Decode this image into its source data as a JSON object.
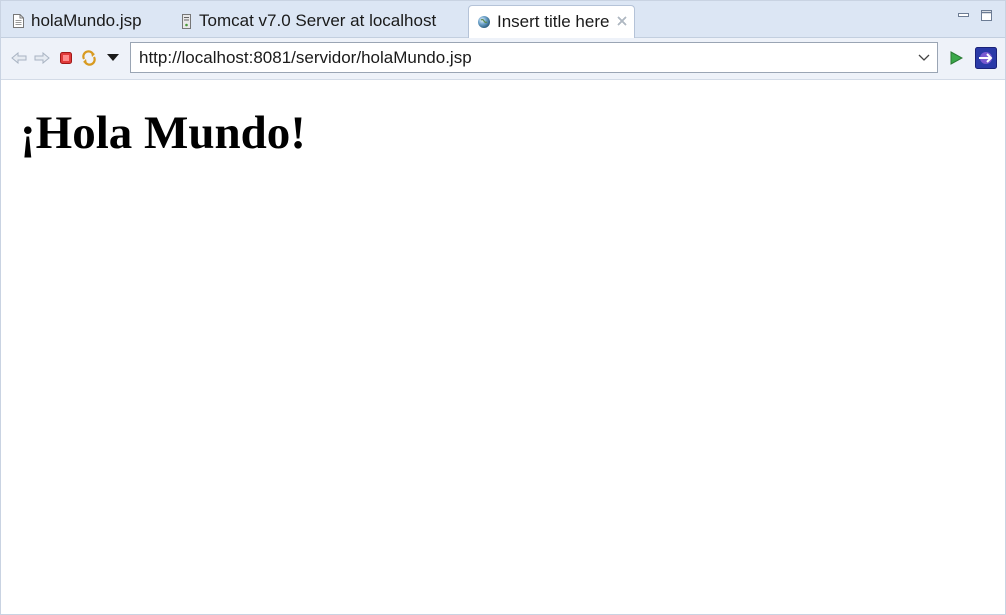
{
  "tabs": [
    {
      "label": "holaMundo.jsp",
      "icon": "jsp-file-icon",
      "active": false
    },
    {
      "label": "Tomcat v7.0 Server at localhost",
      "icon": "server-icon",
      "active": false
    },
    {
      "label": "Insert title here",
      "icon": "globe-icon",
      "active": true,
      "close_icon": "close-icon"
    }
  ],
  "window_controls": {
    "minimize": "minimize-icon",
    "maximize": "maximize-icon"
  },
  "toolbar": {
    "back_icon": "back-arrow-icon",
    "forward_icon": "forward-arrow-icon",
    "stop_icon": "stop-icon",
    "refresh_icon": "refresh-icon",
    "menu_icon": "dropdown-menu-icon",
    "url": "http://localhost:8081/servidor/holaMundo.jsp",
    "go_icon": "go-icon",
    "browser_icon": "browser-icon"
  },
  "page": {
    "heading": "¡Hola Mundo!"
  },
  "colors": {
    "tabbar_bg": "#dce6f4",
    "toolbar_bg": "#eef2f9",
    "accent": "#2a64c5"
  }
}
